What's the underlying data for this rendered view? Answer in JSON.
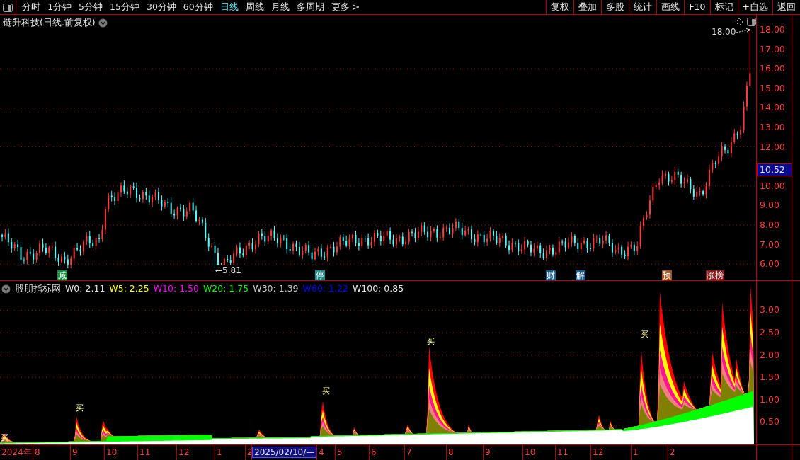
{
  "toolbar": {
    "periods": [
      {
        "label": "分时",
        "selected": false
      },
      {
        "label": "1分钟",
        "selected": false
      },
      {
        "label": "5分钟",
        "selected": false
      },
      {
        "label": "15分钟",
        "selected": false
      },
      {
        "label": "30分钟",
        "selected": false
      },
      {
        "label": "60分钟",
        "selected": false
      },
      {
        "label": "日线",
        "selected": true
      },
      {
        "label": "周线",
        "selected": false
      },
      {
        "label": "月线",
        "selected": false
      },
      {
        "label": "多周期",
        "selected": false
      },
      {
        "label": "更多 >",
        "selected": false
      }
    ],
    "buttons": [
      "复权",
      "叠加",
      "多股",
      "统计",
      "画线",
      "F10",
      "标记",
      "+自选",
      "返回"
    ]
  },
  "price_chart": {
    "title": "链升科技(日线.前复权)",
    "high_label": "18.00",
    "low_label": "←5.81",
    "current_price": "10.52",
    "price_axis": [
      "18.00",
      "17.00",
      "16.00",
      "15.00",
      "14.00",
      "13.00",
      "12.00",
      "10.00",
      "9.00",
      "8.00",
      "7.00",
      "6.00"
    ],
    "events": [
      {
        "label": "减",
        "color": "#108c3c"
      },
      {
        "label": "停",
        "color": "#1c8c8c"
      },
      {
        "label": "财",
        "color": "#1c5c8c"
      },
      {
        "label": "解",
        "color": "#1c5c8c"
      },
      {
        "label": "预",
        "color": "#a8581c"
      },
      {
        "label": "涨榜",
        "color": "#8c1c1c"
      }
    ]
  },
  "indicator": {
    "name": "股朋指标网",
    "legend": [
      {
        "label": "W0: 2.11",
        "color": "#e8e8e8"
      },
      {
        "label": "W5: 2.25",
        "color": "#ffff00"
      },
      {
        "label": "W10: 1.50",
        "color": "#ff00ff"
      },
      {
        "label": "W20: 1.75",
        "color": "#00ff00"
      },
      {
        "label": "W30: 1.39",
        "color": "#c8c8c8"
      },
      {
        "label": "W60: 1.22",
        "color": "#0000ff"
      },
      {
        "label": "W100: 0.85",
        "color": "#e8e8e8"
      }
    ],
    "buy_signals": [
      "买",
      "买",
      "买",
      "买",
      "买"
    ],
    "value_axis": [
      "3.00",
      "2.50",
      "2.00",
      "1.50",
      "1.00",
      "0.50"
    ]
  },
  "date_axis": [
    {
      "label": "2024年",
      "selected": false
    },
    {
      "label": "8",
      "selected": false
    },
    {
      "label": "9",
      "selected": false
    },
    {
      "label": "10",
      "selected": false
    },
    {
      "label": "11",
      "selected": false
    },
    {
      "label": "12",
      "selected": false
    },
    {
      "label": "1",
      "selected": false
    },
    {
      "label": "2",
      "selected": false
    },
    {
      "label": "2025/02/10/—",
      "selected": true
    },
    {
      "label": "4",
      "selected": false
    },
    {
      "label": "5",
      "selected": false
    },
    {
      "label": "6",
      "selected": false
    },
    {
      "label": "7",
      "selected": false
    },
    {
      "label": "8",
      "selected": false
    },
    {
      "label": "9",
      "selected": false
    },
    {
      "label": "10",
      "selected": false
    },
    {
      "label": "11",
      "selected": false
    },
    {
      "label": "12",
      "selected": false
    },
    {
      "label": "1",
      "selected": false
    },
    {
      "label": "2",
      "selected": false
    }
  ]
}
